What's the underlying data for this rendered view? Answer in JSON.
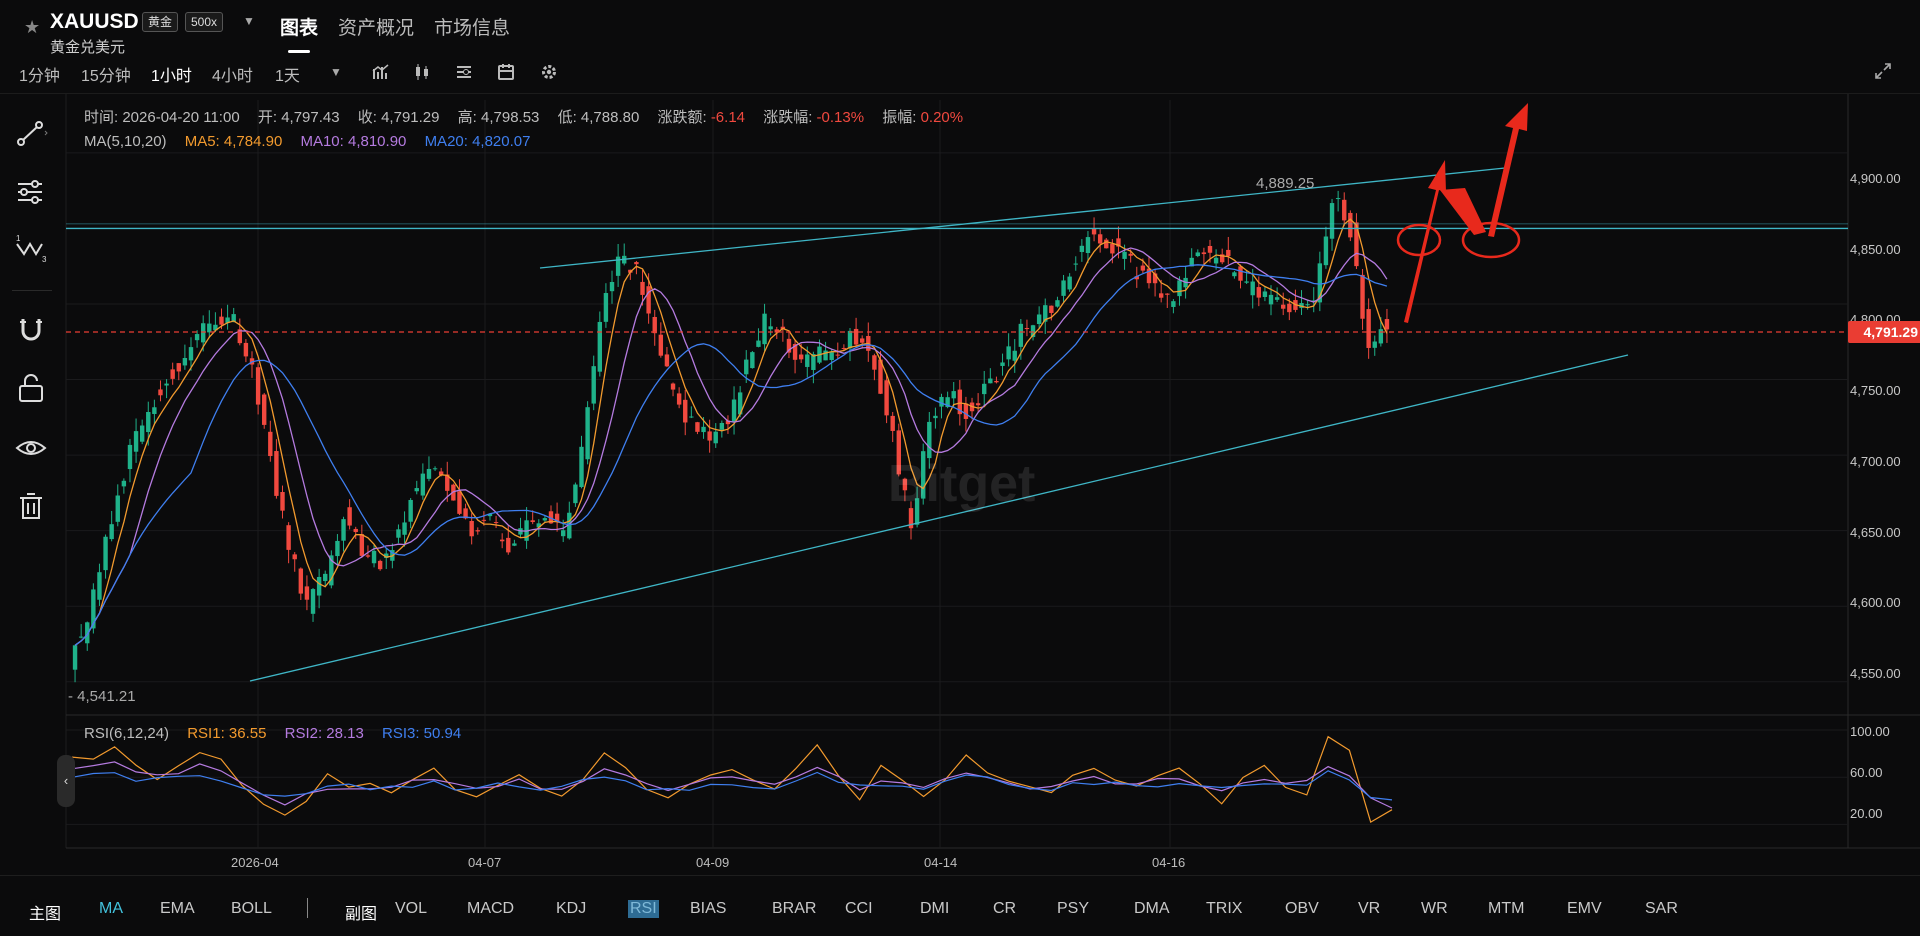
{
  "header": {
    "symbol": "XAUUSD",
    "badge_gold": "黄金",
    "badge_leverage": "500x",
    "subtitle": "黄金兑美元",
    "tabs": [
      "图表",
      "资产概况",
      "市场信息"
    ]
  },
  "timeframes": [
    "1分钟",
    "15分钟",
    "1小时",
    "4小时",
    "1天"
  ],
  "active_timeframe": "1小时",
  "ohlc": {
    "time_label": "时间:",
    "time": "2026-04-20 11:00",
    "open_label": "开:",
    "open": "4,797.43",
    "close_label": "收:",
    "close": "4,791.29",
    "high_label": "高:",
    "high": "4,798.53",
    "low_label": "低:",
    "low": "4,788.80",
    "change_label": "涨跌额:",
    "change": "-6.14",
    "change_pct_label": "涨跌幅:",
    "change_pct": "-0.13%",
    "amplitude_label": "振幅:",
    "amplitude": "0.20%"
  },
  "ma": {
    "title": "MA(5,10,20)",
    "ma5": "MA5: 4,784.90",
    "ma10": "MA10: 4,810.90",
    "ma20": "MA20: 4,820.07"
  },
  "rsi": {
    "title": "RSI(6,12,24)",
    "rsi1": "RSI1: 36.55",
    "rsi2": "RSI2: 28.13",
    "rsi3": "RSI3: 50.94"
  },
  "price_axis": [
    "4,900.00",
    "4,850.00",
    "4,800.00",
    "4,750.00",
    "4,700.00",
    "4,650.00",
    "4,600.00",
    "4,550.00"
  ],
  "rsi_axis": [
    "100.00",
    "60.00",
    "20.00"
  ],
  "x_axis": [
    "2026-04",
    "04-07",
    "04-09",
    "04-14",
    "04-16"
  ],
  "current_price": "4,791.29",
  "chart_high": "4,889.25",
  "chart_low": "4,541.21",
  "watermark": "Bitget",
  "bottom_main_label": "主图",
  "bottom_main": [
    "MA",
    "EMA",
    "BOLL"
  ],
  "bottom_sub_label": "副图",
  "bottom_sub": [
    "VOL",
    "MACD",
    "KDJ",
    "RSI",
    "BIAS",
    "BRAR",
    "CCI",
    "DMI",
    "CR",
    "PSY",
    "DMA",
    "TRIX",
    "OBV",
    "VR",
    "WR",
    "MTM",
    "EMV",
    "SAR"
  ],
  "active_main": "MA",
  "active_sub": "RSI",
  "colors": {
    "up": "#1fb28a",
    "down": "#f1493f",
    "ma5": "#f29a2e",
    "ma10": "#b57be0",
    "ma20": "#3f7ff0",
    "trendline": "#3fb6c6",
    "annotation": "#e8291c"
  },
  "chart_data": {
    "type": "candlestick",
    "ylim": [
      4530,
      4935
    ],
    "price_series": [
      4565,
      4590,
      4640,
      4690,
      4720,
      4745,
      4760,
      4780,
      4792,
      4790,
      4760,
      4700,
      4640,
      4600,
      4620,
      4660,
      4640,
      4625,
      4650,
      4680,
      4690,
      4670,
      4650,
      4655,
      4640,
      4655,
      4660,
      4650,
      4700,
      4790,
      4830,
      4820,
      4780,
      4740,
      4720,
      4710,
      4720,
      4760,
      4790,
      4780,
      4760,
      4765,
      4770,
      4780,
      4760,
      4710,
      4650,
      4720,
      4740,
      4730,
      4745,
      4760,
      4780,
      4790,
      4800,
      4830,
      4850,
      4840,
      4825,
      4815,
      4800,
      4820,
      4835,
      4830,
      4815,
      4805,
      4800,
      4795,
      4800,
      4870,
      4850,
      4770,
      4790
    ],
    "rsi_series": [
      80,
      75,
      85,
      70,
      60,
      70,
      80,
      75,
      55,
      40,
      25,
      40,
      60,
      50,
      55,
      45,
      60,
      70,
      50,
      45,
      55,
      65,
      50,
      45,
      60,
      80,
      70,
      50,
      45,
      55,
      60,
      65,
      55,
      50,
      70,
      85,
      60,
      40,
      70,
      55,
      45,
      60,
      80,
      65,
      55,
      50,
      45,
      60,
      70,
      55,
      50,
      60,
      65,
      55,
      40,
      60,
      70,
      50,
      45,
      95,
      80,
      20,
      30
    ]
  }
}
